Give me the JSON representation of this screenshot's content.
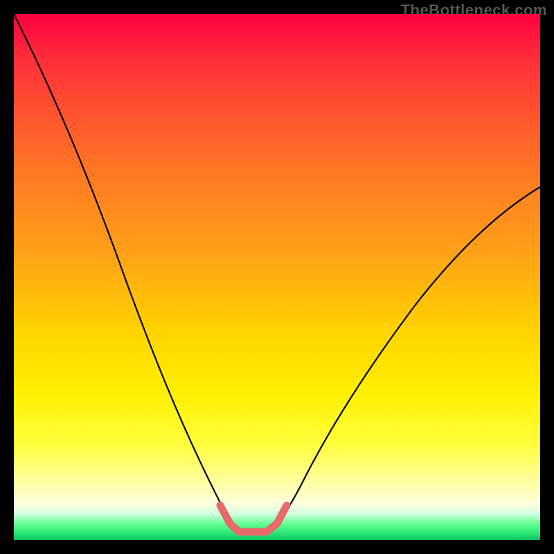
{
  "watermark": "TheBottleneck.com",
  "colors": {
    "frame": "#000000",
    "gradient_top": "#ff0040",
    "gradient_mid": "#ffff00",
    "gradient_bottom": "#20e070",
    "curve": "#000000",
    "highlight": "#e86a6a"
  },
  "chart_data": {
    "type": "line",
    "title": "",
    "xlabel": "",
    "ylabel": "",
    "xlim": [
      0,
      100
    ],
    "ylim": [
      0,
      100
    ],
    "description": "V-shaped bottleneck curve on vertical red→yellow→green gradient; minimum (near zero) occurs roughly between x≈40 and x≈50. A short pink segment highlights the flat bottom of the curve.",
    "series": [
      {
        "name": "bottleneck-curve",
        "color": "#000000",
        "x": [
          0,
          5,
          10,
          15,
          20,
          25,
          30,
          35,
          38,
          40,
          42,
          45,
          48,
          50,
          52,
          55,
          60,
          65,
          70,
          75,
          80,
          85,
          90,
          95,
          100
        ],
        "values": [
          100,
          88,
          75,
          62,
          50,
          38,
          27,
          15,
          8,
          3,
          1,
          0,
          0,
          1,
          3,
          7,
          14,
          22,
          30,
          38,
          45,
          52,
          58,
          62,
          65
        ]
      },
      {
        "name": "highlight-bottom",
        "color": "#e86a6a",
        "x": [
          38,
          40,
          42,
          45,
          48,
          50,
          52
        ],
        "values": [
          8,
          3,
          1,
          0,
          0,
          1,
          3
        ]
      }
    ]
  }
}
